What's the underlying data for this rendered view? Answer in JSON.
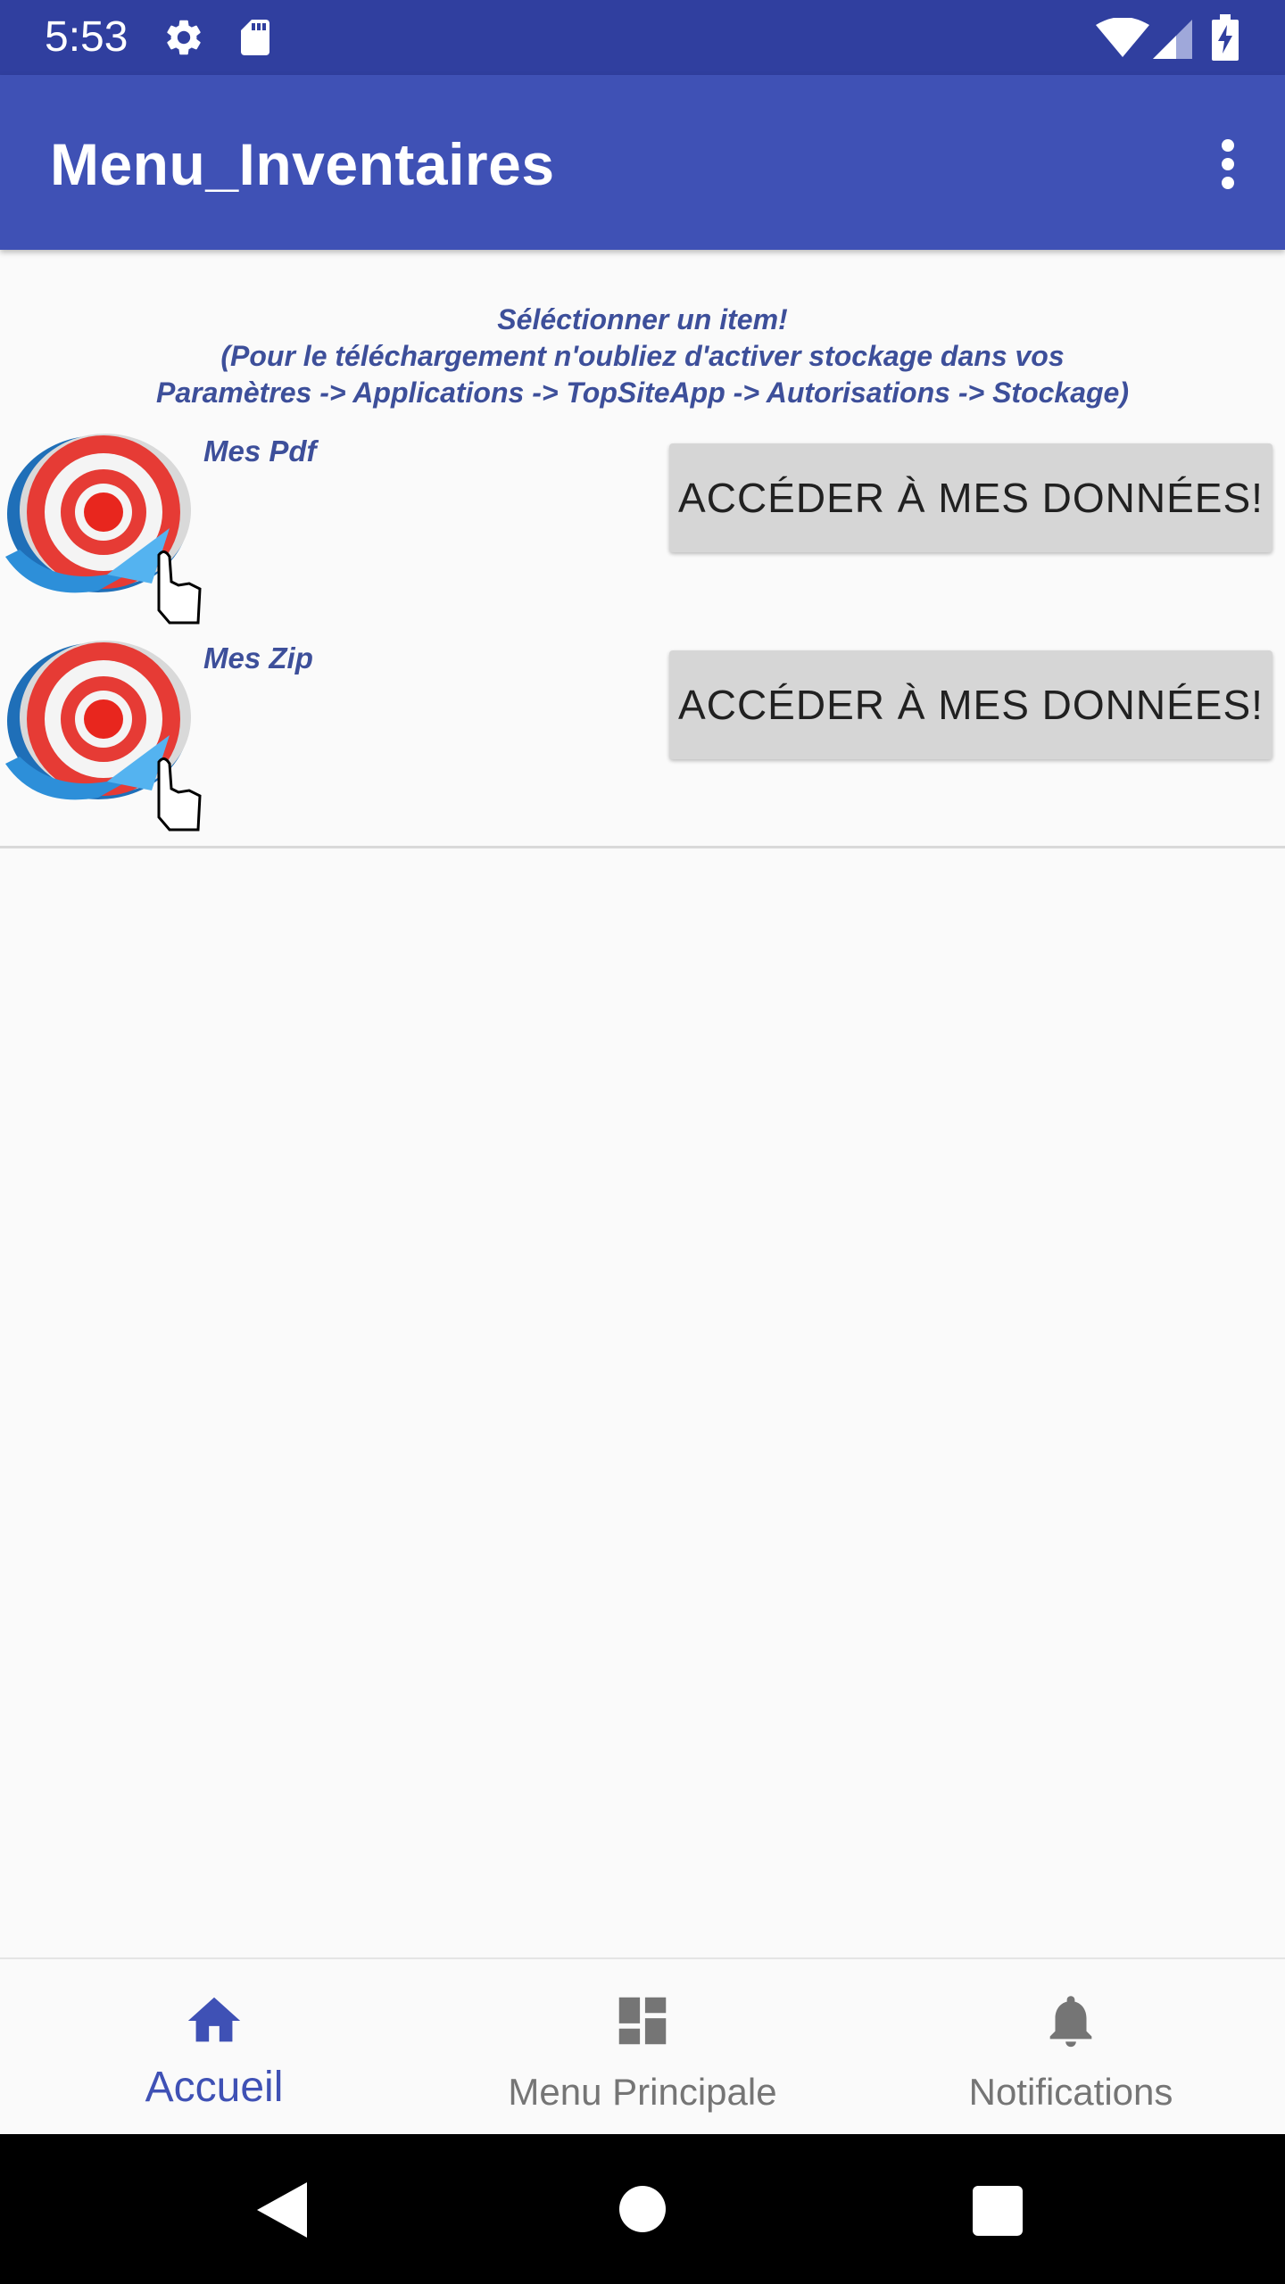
{
  "status_bar": {
    "time": "5:53",
    "icons": [
      "settings-icon",
      "sd-card-icon",
      "wifi-icon",
      "cell-signal-icon",
      "battery-charging-icon"
    ]
  },
  "app_bar": {
    "title": "Menu_Inventaires",
    "overflow_icon": "more-vert-icon"
  },
  "instructions": {
    "line1": "Séléctionner un item!",
    "line2": "(Pour le téléchargement n'oubliez d'activer stockage dans vos",
    "line3": "Paramètres -> Applications -> TopSiteApp -> Autorisations -> Stockage)"
  },
  "items": [
    {
      "label": "Mes Pdf",
      "button": "ACCÉDER À MES DONNÉES!"
    },
    {
      "label": "Mes Zip",
      "button": "ACCÉDER À MES DONNÉES!"
    }
  ],
  "bottom_nav": {
    "items": [
      {
        "label": "Accueil",
        "icon": "home-icon",
        "active": true
      },
      {
        "label": "Menu Principale",
        "icon": "dashboard-icon",
        "active": false
      },
      {
        "label": "Notifications",
        "icon": "bell-icon",
        "active": false
      }
    ]
  },
  "colors": {
    "status_bar": "#303f9f",
    "primary": "#3f51b5",
    "label_text": "#3d4f9a",
    "button_bg": "#d6d6d6",
    "inactive": "#757575"
  }
}
